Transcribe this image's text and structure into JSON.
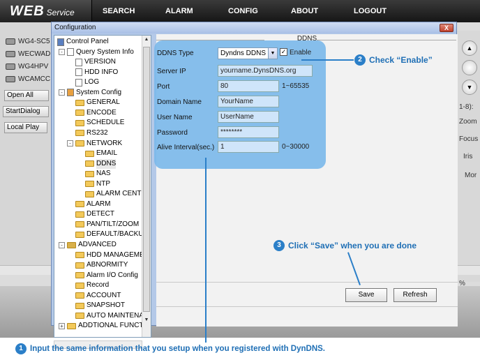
{
  "header": {
    "logo_main": "WEB",
    "logo_sub": "Service",
    "nav": [
      "SEARCH",
      "ALARM",
      "CONFIG",
      "ABOUT",
      "LOGOUT"
    ]
  },
  "left_panel": {
    "cameras": [
      "WG4-SC5",
      "WECWAD",
      "WG4HPV",
      "WCAMCC"
    ],
    "buttons": [
      "Open All",
      "StartDialog",
      "Local Play"
    ]
  },
  "right_panel": {
    "labels": [
      "1-8):",
      "Zoom",
      "Focus",
      "Iris",
      "Mor"
    ],
    "percent": "%"
  },
  "dialog": {
    "title": "Configuration",
    "close_label": "X",
    "section_title": "DDNS"
  },
  "tree": [
    "Control Panel",
    "Query System Info",
    "VERSION",
    "HDD INFO",
    "LOG",
    "System Config",
    "GENERAL",
    "ENCODE",
    "SCHEDULE",
    "RS232",
    "NETWORK",
    "EMAIL",
    "DDNS",
    "NAS",
    "NTP",
    "ALARM CENTE",
    "ALARM",
    "DETECT",
    "PAN/TILT/ZOOM",
    "DEFAULT/BACKUP",
    "ADVANCED",
    "HDD MANAGEMEI",
    "ABNORMITY",
    "Alarm I/O Config",
    "Record",
    "ACCOUNT",
    "SNAPSHOT",
    "AUTO MAINTENAI",
    "ADDTIONAL FUNCTIC"
  ],
  "form": {
    "ddns_type_label": "DDNS Type",
    "ddns_type_value": "Dyndns DDNS",
    "enable_label": "Enable",
    "enable_checked": true,
    "server_ip_label": "Server IP",
    "server_ip_value": "yourname.DynsDNS.org",
    "port_label": "Port",
    "port_value": "80",
    "port_hint": "1~65535",
    "domain_label": "Domain Name",
    "domain_value": "YourName",
    "user_label": "User Name",
    "user_value": "UserName",
    "password_label": "Password",
    "password_value": "********",
    "alive_label": "Alive Interval(sec.)",
    "alive_value": "1",
    "alive_hint": "0~30000"
  },
  "buttons": {
    "save": "Save",
    "refresh": "Refresh"
  },
  "callouts": {
    "step1_num": "1",
    "step1_text": "Input the same information that you setup when you registered with DynDNS.",
    "step2_num": "2",
    "step2_text": "Check “Enable”",
    "step3_num": "3",
    "step3_text": "Click “Save” when you are done"
  },
  "colors": {
    "highlight": "#7ab8ea",
    "callout": "#1f6fb5",
    "topbar": "#1c1c1c"
  }
}
